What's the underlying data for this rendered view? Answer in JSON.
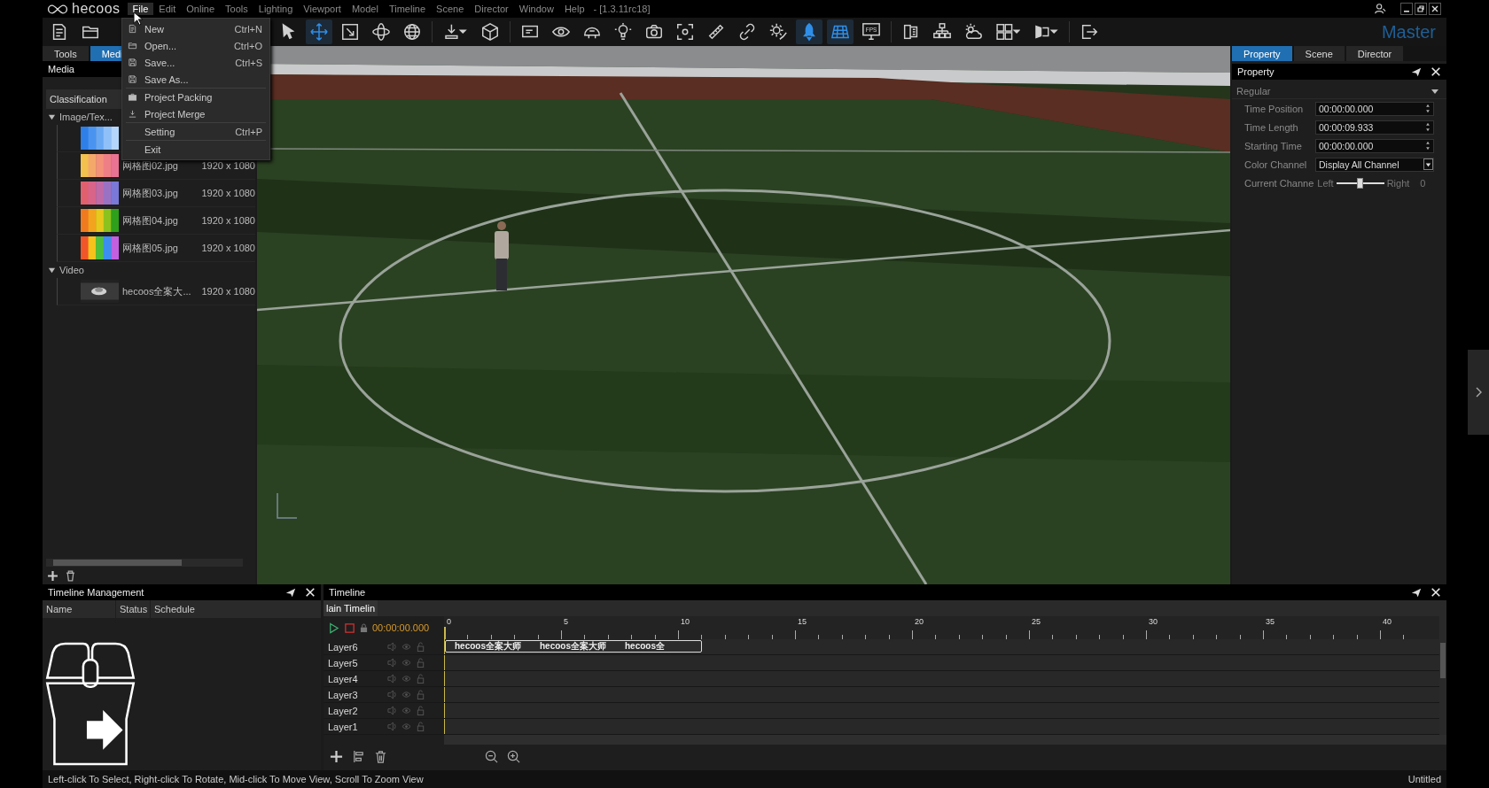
{
  "app": {
    "logo": "hecoos",
    "version": "- [1.3.11rc18]",
    "workspace": "Master"
  },
  "menu": [
    {
      "label": "File",
      "selected": true
    },
    {
      "label": "Edit",
      "selected": false
    },
    {
      "label": "Online",
      "selected": false
    },
    {
      "label": "Tools",
      "selected": false
    },
    {
      "label": "Lighting",
      "selected": false
    },
    {
      "label": "Viewport",
      "selected": false
    },
    {
      "label": "Model",
      "selected": false
    },
    {
      "label": "Timeline",
      "selected": false
    },
    {
      "label": "Scene",
      "selected": false
    },
    {
      "label": "Director",
      "selected": false
    },
    {
      "label": "Window",
      "selected": false
    },
    {
      "label": "Help",
      "selected": false
    }
  ],
  "file_menu": [
    {
      "kind": "document",
      "label": "New",
      "shortcut": "Ctrl+N"
    },
    {
      "kind": "folder",
      "label": "Open...",
      "shortcut": "Ctrl+O"
    },
    {
      "kind": "disk",
      "label": "Save...",
      "shortcut": "Ctrl+S"
    },
    {
      "kind": "disk",
      "label": "Save As..."
    },
    {
      "kind": "separator"
    },
    {
      "kind": "briefcase",
      "label": "Project Packing"
    },
    {
      "kind": "merge",
      "label": "Project Merge"
    },
    {
      "kind": "separator"
    },
    {
      "kind": "plain",
      "label": "Setting",
      "shortcut": "Ctrl+P"
    },
    {
      "kind": "separator"
    },
    {
      "kind": "plain",
      "label": "Exit"
    }
  ],
  "toolbar": {
    "file_tools": [
      {
        "kind": "document",
        "selected": false
      },
      {
        "kind": "folder",
        "selected": false
      }
    ],
    "tools": [
      {
        "kind": "cursor",
        "selected": false
      },
      {
        "kind": "move",
        "selected": true
      },
      {
        "kind": "scale",
        "selected": false
      },
      {
        "kind": "orbit",
        "selected": false
      },
      {
        "kind": "globe",
        "selected": false
      },
      {
        "kind": "separator"
      },
      {
        "kind": "download",
        "selected": false
      },
      {
        "kind": "cube",
        "selected": false
      },
      {
        "kind": "separator"
      },
      {
        "kind": "screen",
        "selected": false
      },
      {
        "kind": "eye",
        "selected": false
      },
      {
        "kind": "dome",
        "selected": false
      },
      {
        "kind": "bulb",
        "selected": false
      },
      {
        "kind": "camera",
        "selected": false
      },
      {
        "kind": "focus",
        "selected": false
      },
      {
        "kind": "ruler",
        "selected": false
      },
      {
        "kind": "link",
        "selected": false
      },
      {
        "kind": "sun",
        "selected": false
      },
      {
        "kind": "rocket",
        "selected": true
      },
      {
        "kind": "grid",
        "selected": true
      },
      {
        "kind": "monitor",
        "selected": false,
        "label": "FPS"
      },
      {
        "kind": "separator"
      },
      {
        "kind": "display",
        "selected": false
      },
      {
        "kind": "network",
        "selected": false
      },
      {
        "kind": "weather",
        "selected": false
      },
      {
        "kind": "tiles",
        "selected": false
      },
      {
        "kind": "split",
        "selected": false
      },
      {
        "kind": "separator"
      },
      {
        "kind": "exit",
        "selected": false
      }
    ]
  },
  "left_panel": {
    "tabs": [
      {
        "label": "Tools",
        "selected": false
      },
      {
        "label": "Medi",
        "selected": true
      }
    ],
    "title": "Media",
    "header": "Classification",
    "tree": [
      {
        "label": "Image/Tex...",
        "expanded": true,
        "children": [
          {
            "kind": "picture"
          },
          {
            "kind": "picture",
            "name": "网格图02.jpg",
            "size": "1920 x 1080"
          },
          {
            "kind": "picture",
            "name": "网格图03.jpg",
            "size": "1920 x 1080"
          },
          {
            "kind": "picture",
            "name": "网格图04.jpg",
            "size": "1920 x 1080"
          },
          {
            "kind": "picture",
            "name": "网格图05.jpg",
            "size": "1920 x 1080"
          }
        ]
      },
      {
        "label": "Video",
        "expanded": true,
        "children": [
          {
            "kind": "picture",
            "name": "hecoos全案大...",
            "size": "1920 x 1080"
          }
        ]
      }
    ]
  },
  "right_panel": {
    "tabs": [
      {
        "label": "Property",
        "selected": true
      },
      {
        "label": "Scene",
        "selected": false
      },
      {
        "label": "Director",
        "selected": false
      }
    ],
    "title": "Property",
    "section": {
      "label": "Regular",
      "expanded": true
    },
    "fields": [
      {
        "kind": "spin",
        "label": "Time Position",
        "value": "00:00:00.000"
      },
      {
        "kind": "spin",
        "label": "Time Length",
        "value": "00:00:09.933"
      },
      {
        "kind": "spin",
        "label": "Starting Time",
        "value": "00:00:00.000"
      },
      {
        "kind": "select",
        "label": "Color Channel",
        "value": "Display All Channel"
      },
      {
        "kind": "slider",
        "label": "Current Channe",
        "left": "Left",
        "right": "Right",
        "level": 0.5,
        "reading": "0"
      }
    ]
  },
  "timeline_management": {
    "title": "Timeline Management",
    "columns": [
      "Name",
      "Status",
      "Schedule"
    ]
  },
  "timeline": {
    "title": "Timeline",
    "tabs": [
      {
        "label": "lain Timelin",
        "selected": true
      }
    ],
    "time": "00:00:00.000",
    "ruler": [
      "0",
      "5",
      "10",
      "15",
      "20",
      "25",
      "30",
      "35",
      "40"
    ],
    "layers": [
      {
        "name": "Layer6",
        "clips": [
          "hecoos全案大师",
          "hecoos全案大师",
          "hecoos全"
        ]
      },
      {
        "name": "Layer5"
      },
      {
        "name": "Layer4"
      },
      {
        "name": "Layer3"
      },
      {
        "name": "Layer2"
      },
      {
        "name": "Layer1"
      }
    ]
  },
  "status_bar": {
    "hint": "Left-click To Select, Right-click To Rotate, Mid-click To Move View, Scroll To Zoom View",
    "document": "Untitled"
  }
}
